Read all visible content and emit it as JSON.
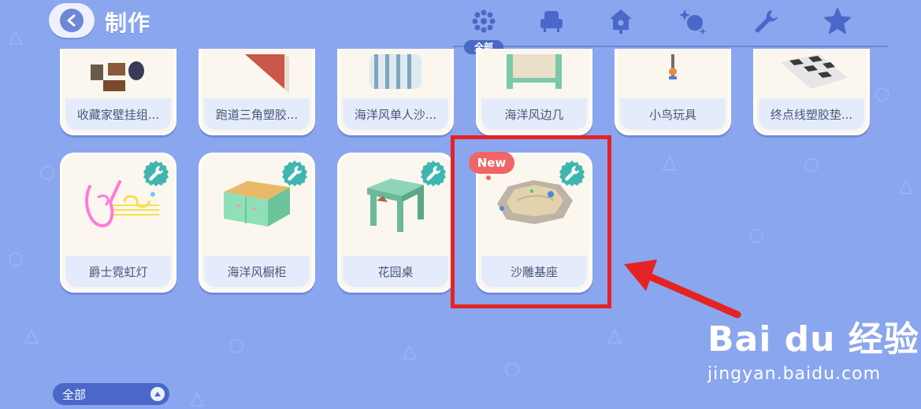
{
  "header": {
    "title": "制作",
    "tabs": [
      {
        "id": "all",
        "icon": "flower-dots-icon",
        "active": true,
        "label": "全部"
      },
      {
        "id": "furniture",
        "icon": "armchair-icon",
        "active": false
      },
      {
        "id": "wall",
        "icon": "birdhouse-icon",
        "active": false
      },
      {
        "id": "toy",
        "icon": "sparkle-ball-icon",
        "active": false
      },
      {
        "id": "tools",
        "icon": "wrench-icon",
        "active": false
      },
      {
        "id": "favorites",
        "icon": "star-icon",
        "active": false
      }
    ]
  },
  "items_row1": [
    {
      "label": "收藏家壁挂组...",
      "icon": "wall-frames-icon"
    },
    {
      "label": "跑道三角塑胶...",
      "icon": "red-triangle-icon"
    },
    {
      "label": "海洋风单人沙...",
      "icon": "striped-sofa-icon"
    },
    {
      "label": "海洋风边几",
      "icon": "side-table-icon"
    },
    {
      "label": "小鸟玩具",
      "icon": "bird-toy-icon"
    },
    {
      "label": "终点线塑胶垫...",
      "icon": "checkered-mat-icon"
    }
  ],
  "items_row2": [
    {
      "label": "爵士霓虹灯",
      "icon": "neon-saxophone-icon",
      "craftable": true,
      "is_new": false
    },
    {
      "label": "海洋风橱柜",
      "icon": "green-cabinet-icon",
      "craftable": true,
      "is_new": false
    },
    {
      "label": "花园桌",
      "icon": "garden-table-icon",
      "craftable": true,
      "is_new": false
    },
    {
      "label": "沙雕基座",
      "icon": "sand-base-icon",
      "craftable": true,
      "is_new": true
    }
  ],
  "new_badge": "New",
  "filter": {
    "label": "全部"
  },
  "watermark": {
    "logo": "Bai du 经验",
    "url": "jingyan.baidu.com"
  },
  "colors": {
    "background": "#8aa6ee",
    "card": "#fbf7ee",
    "label_bg": "#e4ecfb",
    "badge": "#3fb6b0",
    "highlight": "#e52323",
    "accent": "#4a68c8"
  }
}
